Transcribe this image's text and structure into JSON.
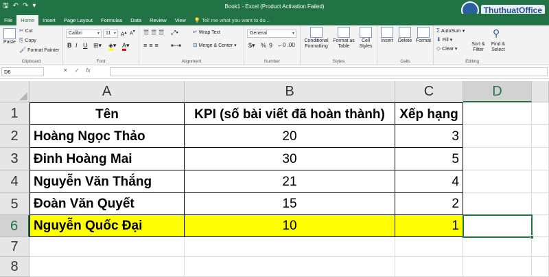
{
  "window": {
    "title": "Book1 - Excel (Product Activation Failed)",
    "brand": "ThuthuatOffice"
  },
  "tabs": [
    "File",
    "Home",
    "Insert",
    "Page Layout",
    "Formulas",
    "Data",
    "Review",
    "View"
  ],
  "tell_me": "Tell me what you want to do...",
  "ribbon": {
    "clipboard": {
      "paste": "Paste",
      "cut": "Cut",
      "copy": "Copy",
      "format_painter": "Format Painter",
      "label": "Clipboard"
    },
    "font": {
      "name": "Calibri",
      "size": "11",
      "label": "Font",
      "bold": "B",
      "italic": "I",
      "underline": "U"
    },
    "alignment": {
      "wrap_text": "Wrap Text",
      "merge_center": "Merge & Center",
      "label": "Alignment"
    },
    "number": {
      "format": "General",
      "currency": "$",
      "percent": "%",
      "comma": "9",
      "label": "Number"
    },
    "styles": {
      "conditional_formatting": "Conditional Formatting",
      "format_as_table": "Format as Table",
      "cell_styles": "Cell Styles",
      "label": "Styles"
    },
    "cells": {
      "insert": "Insert",
      "delete": "Delete",
      "format": "Format",
      "label": "Cells"
    },
    "editing": {
      "autosum": "AutoSum",
      "fill": "Fill",
      "clear": "Clear",
      "sort_filter": "Sort & Filter",
      "find_select": "Find & Select",
      "label": "Editing"
    }
  },
  "formula_bar": {
    "name_box": "D6",
    "fx": "fx",
    "cancel": "✕",
    "enter": "✓",
    "value": ""
  },
  "columns": [
    "A",
    "B",
    "C",
    "D"
  ],
  "rows": [
    "1",
    "2",
    "3",
    "4",
    "5",
    "6",
    "7",
    "8"
  ],
  "sheet": {
    "header": {
      "name": "Tên",
      "kpi": "KPI (số bài viết đã hoàn thành)",
      "rank": "Xếp hạng"
    },
    "records": [
      {
        "name": "Hoàng Ngọc Thảo",
        "kpi": "20",
        "rank": "3"
      },
      {
        "name": "Đinh Hoàng Mai",
        "kpi": "30",
        "rank": "5"
      },
      {
        "name": "Nguyễn Văn Thắng",
        "kpi": "21",
        "rank": "4"
      },
      {
        "name": "Đoàn Văn Quyết",
        "kpi": "15",
        "rank": "2"
      },
      {
        "name": "Nguyễn Quốc Đại",
        "kpi": "10",
        "rank": "1"
      }
    ],
    "selected_cell": "D6",
    "highlight_color": "#ffff00"
  },
  "colors": {
    "excel_green": "#217346"
  }
}
